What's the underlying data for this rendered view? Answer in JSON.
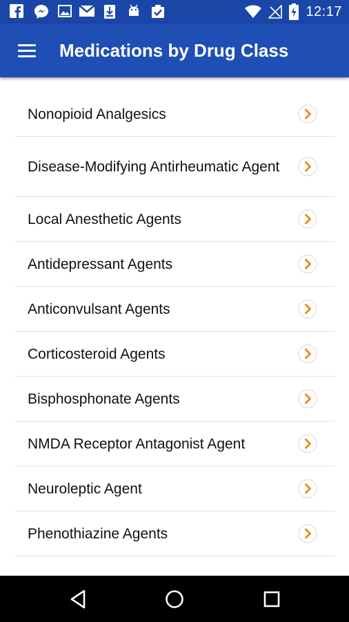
{
  "status_bar": {
    "time": "12:17",
    "left_icons": [
      "facebook-icon",
      "messenger-icon",
      "image-icon",
      "gmail-icon",
      "download-icon",
      "android-icon",
      "clipboard-check-icon"
    ],
    "right_icons": [
      "wifi-icon",
      "no-signal-icon",
      "battery-charging-icon"
    ]
  },
  "app_bar": {
    "title": "Medications by Drug Class",
    "menu_icon": "hamburger-menu-icon"
  },
  "colors": {
    "primary": "#1f4fb4",
    "status_bar": "#1a46a8",
    "accent": "#f08a24",
    "text": "#111111",
    "divider": "#e2e2e2"
  },
  "list": {
    "items": [
      {
        "label": "Nonopioid Analgesics"
      },
      {
        "label": "Disease-Modifying Antirheumatic Agent"
      },
      {
        "label": "Local Anesthetic Agents"
      },
      {
        "label": "Antidepressant Agents"
      },
      {
        "label": "Anticonvulsant Agents"
      },
      {
        "label": "Corticosteroid Agents"
      },
      {
        "label": "Bisphosphonate Agents"
      },
      {
        "label": "NMDA Receptor Antagonist Agent"
      },
      {
        "label": "Neuroleptic Agent"
      },
      {
        "label": "Phenothiazine Agents"
      }
    ],
    "chevron_icon": "chevron-right-circle-icon"
  },
  "nav_bar": {
    "buttons": [
      "back-icon",
      "home-icon",
      "recents-icon"
    ]
  }
}
